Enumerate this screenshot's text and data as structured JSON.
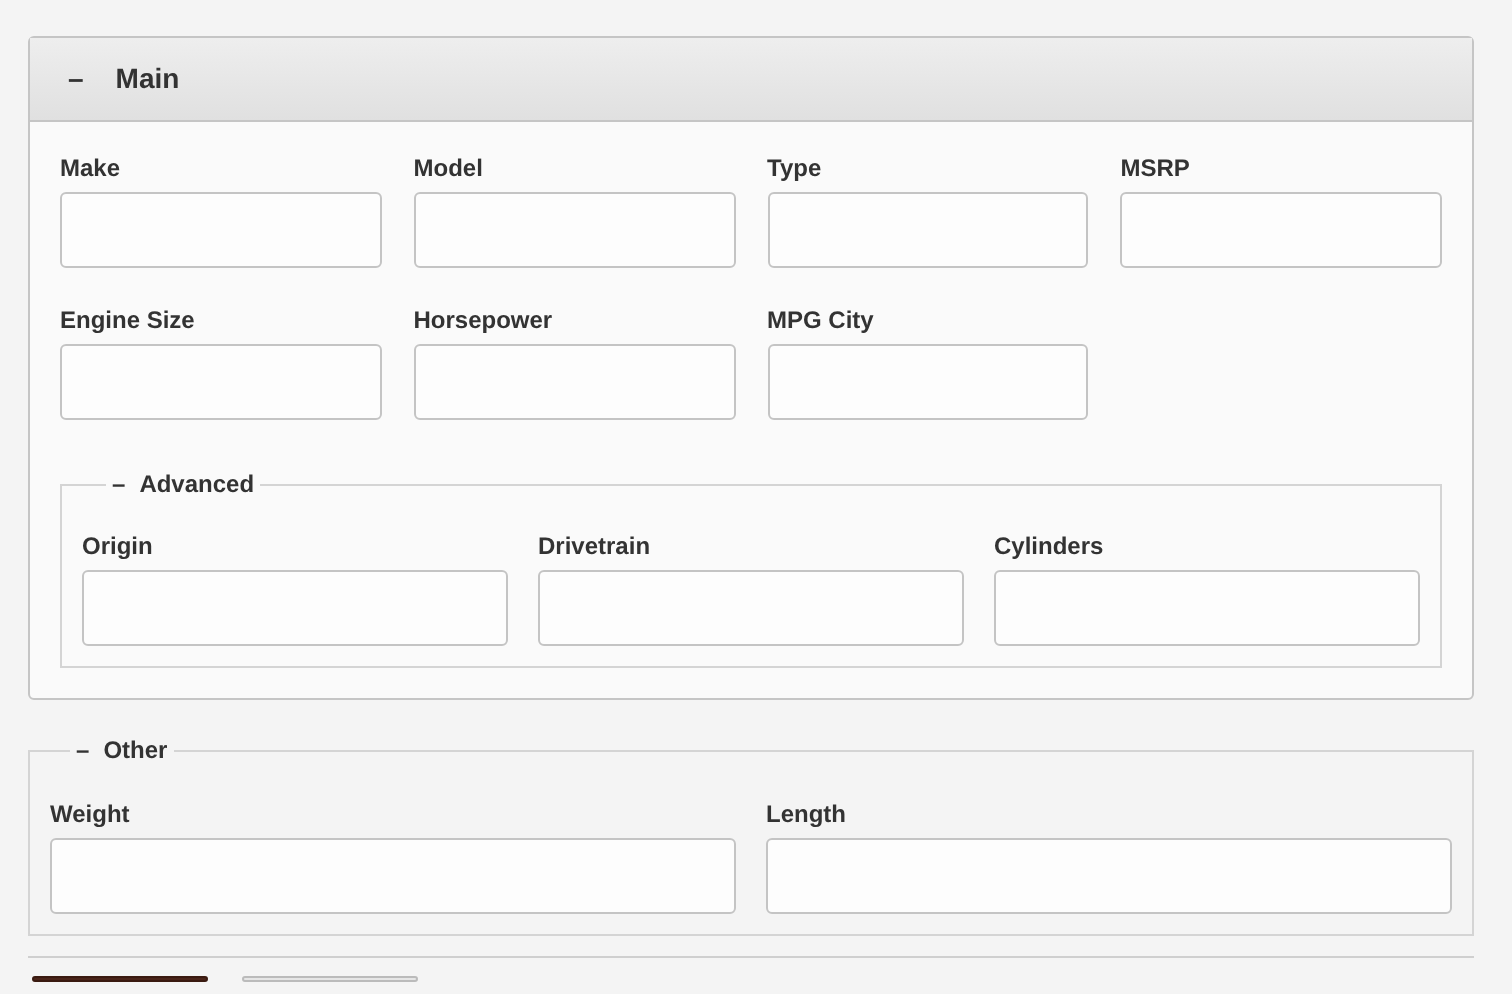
{
  "panel": {
    "title": "Main",
    "toggle": "–",
    "expanded": true,
    "fields": [
      {
        "label": "Make"
      },
      {
        "label": "Model"
      },
      {
        "label": "Type"
      },
      {
        "label": "MSRP"
      },
      {
        "label": "Engine Size"
      },
      {
        "label": "Horsepower"
      },
      {
        "label": "MPG City"
      }
    ],
    "group": {
      "title": "Advanced",
      "toggle": "–",
      "expanded": true,
      "fields": [
        {
          "label": "Origin"
        },
        {
          "label": "Drivetrain"
        },
        {
          "label": "Cylinders"
        }
      ]
    }
  },
  "other": {
    "title": "Other",
    "toggle": "–",
    "expanded": true,
    "fields": [
      {
        "label": "Weight"
      },
      {
        "label": "Length"
      }
    ]
  },
  "buttons": [
    {
      "kind": "primary"
    },
    {
      "kind": "secondary"
    }
  ]
}
